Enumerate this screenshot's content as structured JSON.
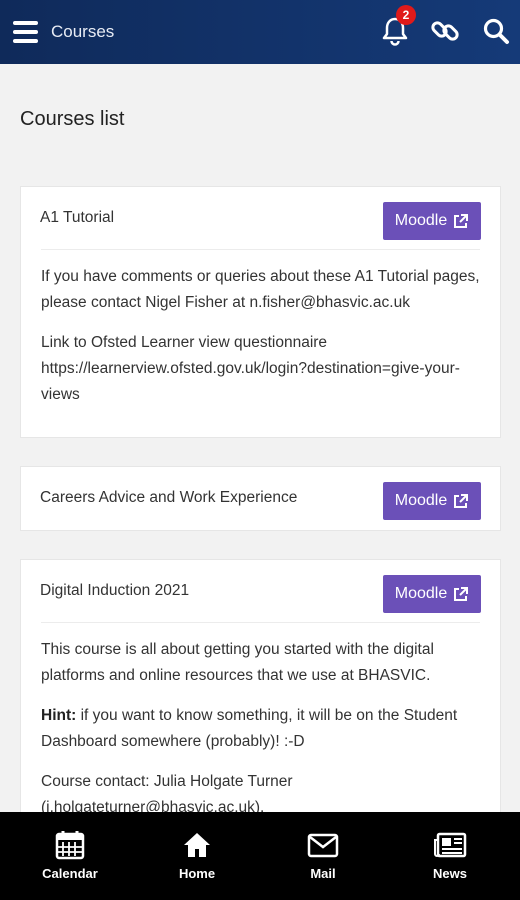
{
  "header": {
    "title": "Courses",
    "notification_count": "2",
    "icons": [
      "menu-icon",
      "bell-icon",
      "link-icon",
      "search-icon"
    ],
    "bar_color": "#132f66"
  },
  "page": {
    "title": "Courses list"
  },
  "courses": [
    {
      "title": "A1 Tutorial",
      "button_label": "Moodle",
      "body": [
        "If you have comments or queries about these A1 Tutorial pages, please contact Nigel Fisher at n.fisher@bhasvic.ac.uk",
        "Link to Ofsted Learner view questionnaire https://learnerview.ofsted.gov.uk/login?destination=give-your-views"
      ]
    },
    {
      "title": "Careers Advice and Work Experience",
      "button_label": "Moodle",
      "body": []
    },
    {
      "title": "Digital Induction 2021",
      "button_label": "Moodle",
      "body": [
        "This course is all about getting you started with the digital platforms and online resources that we use at BHASVIC."
      ],
      "hint_label": "Hint:",
      "hint_text": " if you want to know something, it will be on the Student Dashboard somewhere (probably)! :-D",
      "contact": "Course contact: Julia Holgate Turner (j.holgateturner@bhasvic.ac.uk)."
    }
  ],
  "button_color": "#6b50b8",
  "bottom_nav": [
    {
      "label": "Calendar",
      "icon": "calendar-icon"
    },
    {
      "label": "Home",
      "icon": "home-icon"
    },
    {
      "label": "Mail",
      "icon": "mail-icon"
    },
    {
      "label": "News",
      "icon": "newspaper-icon"
    }
  ]
}
